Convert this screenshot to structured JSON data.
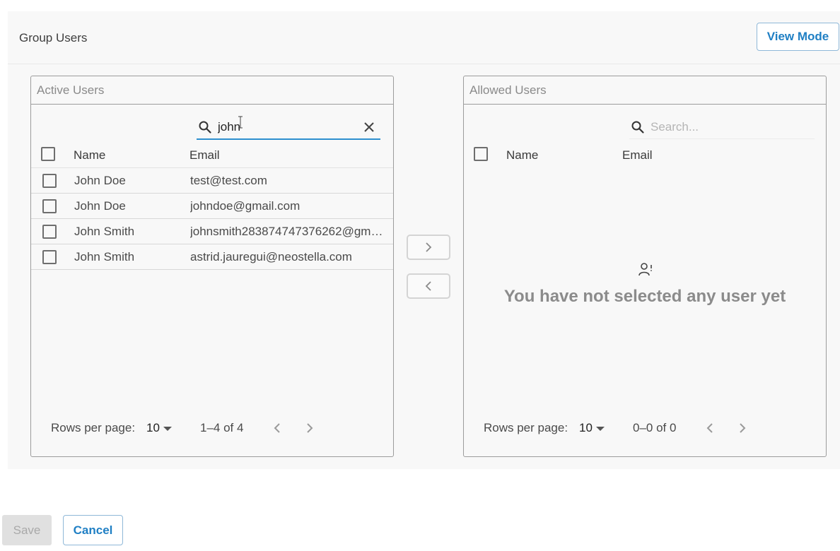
{
  "header": {
    "title": "Group Users",
    "view_mode_label": "View Mode"
  },
  "active_panel": {
    "title": "Active Users",
    "search_value": "john",
    "columns": [
      "Name",
      "Email"
    ],
    "rows": [
      {
        "name": "John Doe",
        "email": "test@test.com"
      },
      {
        "name": "John Doe",
        "email": "johndoe@gmail.com"
      },
      {
        "name": "John Smith",
        "email": "johnsmith283874747376262@gm…"
      },
      {
        "name": "John Smith",
        "email": "astrid.jauregui@neostella.com"
      }
    ],
    "footer": {
      "rows_per_page_label": "Rows per page:",
      "rows_per_page": "10",
      "range": "1–4 of 4"
    }
  },
  "transfer": {
    "move_right_icon": "chevron-right-icon",
    "move_left_icon": "chevron-left-icon"
  },
  "allowed_panel": {
    "title": "Allowed Users",
    "search_placeholder": "Search...",
    "columns": [
      "Name",
      "Email"
    ],
    "empty_message": "You have not selected any user yet",
    "footer": {
      "rows_per_page_label": "Rows per page:",
      "rows_per_page": "10",
      "range": "0–0 of 0"
    }
  },
  "actions": {
    "save_label": "Save",
    "cancel_label": "Cancel"
  },
  "colors": {
    "accent": "#1f7fc4",
    "search_underline": "#2d8fcf",
    "panel_border": "#9c9c9c"
  }
}
